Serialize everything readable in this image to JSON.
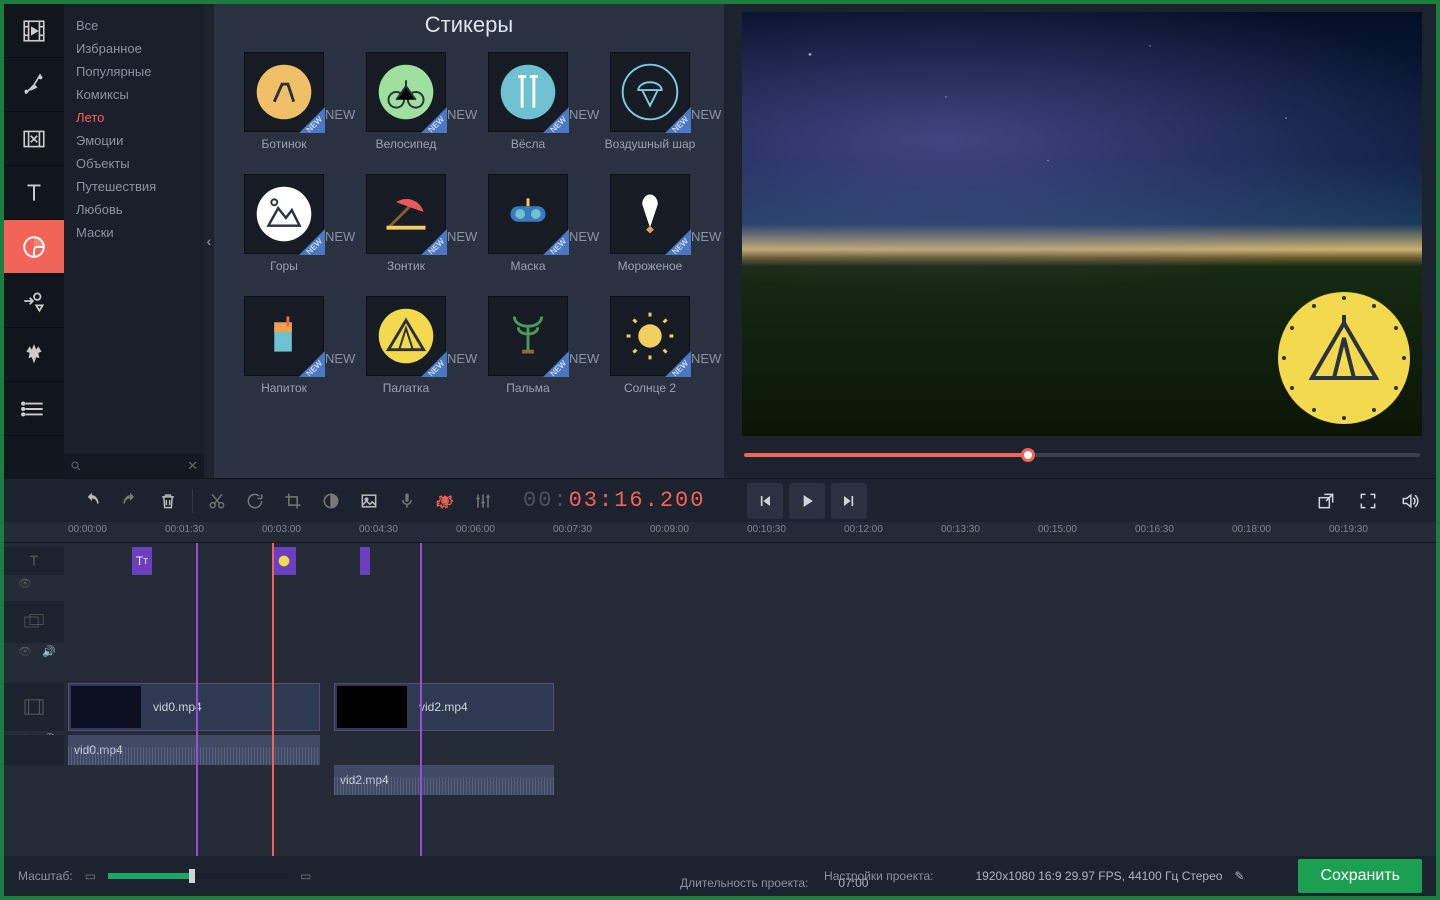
{
  "panel_title": "Стикеры",
  "categories": [
    "Все",
    "Избранное",
    "Популярные",
    "Комиксы",
    "Лето",
    "Эмоции",
    "Объекты",
    "Путешествия",
    "Любовь",
    "Маски"
  ],
  "selected_category": "Лето",
  "stickers": [
    {
      "name": "Ботинок"
    },
    {
      "name": "Велосипед"
    },
    {
      "name": "Вёсла"
    },
    {
      "name": "Воздушный шар"
    },
    {
      "name": "Горы"
    },
    {
      "name": "Зонтик"
    },
    {
      "name": "Маска"
    },
    {
      "name": "Мороженое"
    },
    {
      "name": "Напиток"
    },
    {
      "name": "Палатка"
    },
    {
      "name": "Пальма"
    },
    {
      "name": "Солнце 2"
    }
  ],
  "timecode": {
    "grey": "00:",
    "red": "03:16.200"
  },
  "ruler": [
    "00:00:00",
    "00:01:30",
    "00:03:00",
    "00:04:30",
    "00:06:00",
    "00:07:30",
    "00:09:00",
    "00:10:30",
    "00:12:00",
    "00:13:30",
    "00:15:00",
    "00:16:30",
    "00:18:00",
    "00:19:30"
  ],
  "clips": {
    "v0": "vid0.mp4",
    "v2": "vid2.mp4",
    "a0": "vid0.mp4",
    "a2": "vid2.mp4",
    "t": "T"
  },
  "footer": {
    "zoom_label": "Масштаб:",
    "settings_label": "Настройки проекта:",
    "settings_value": "1920x1080 16:9 29.97 FPS, 44100 Гц Стерео",
    "duration_label": "Длительность проекта:",
    "duration_value": "07:00",
    "save": "Сохранить"
  }
}
